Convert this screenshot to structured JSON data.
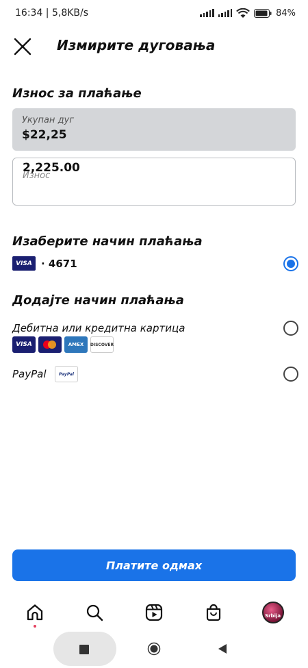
{
  "status_bar": {
    "time_speed": "16:34 | 5,8KB/s",
    "battery": "84%"
  },
  "header": {
    "title": "Измирите дуговања",
    "close_icon": "close-icon"
  },
  "payment_amount": {
    "section_title": "Износ за плаћање",
    "total_label": "Укупан дуг",
    "total_value": "$22,25",
    "amount_value": "2,225.00",
    "amount_placeholder": "Износ"
  },
  "payment_method": {
    "section_title": "Изаберите начин плаћања",
    "card_brand": "VISA",
    "card_digits": "· 4671",
    "selected": true
  },
  "add_method": {
    "section_title": "Додајте начин плаћања",
    "card_option_label": "Дебитна или кредитна картица",
    "card_logos": {
      "visa": "VISA",
      "amex": "AMEX",
      "discover": "DISCOVER"
    },
    "paypal_label": "PayPal",
    "paypal_logo": "PayPal"
  },
  "pay_button": {
    "label": "Платите одмах",
    "color": "#1a73e8"
  },
  "bottom_nav": {
    "items": [
      "home-icon",
      "search-icon",
      "reels-icon",
      "shop-icon",
      "profile-avatar"
    ],
    "profile_text": "Srbija"
  },
  "system_nav": {
    "items": [
      "recents-icon",
      "home-circle-icon",
      "back-icon"
    ]
  },
  "colors": {
    "accent": "#1a73e8",
    "total_box_bg": "#d4d6d9",
    "notification_dot": "#e4405f"
  }
}
